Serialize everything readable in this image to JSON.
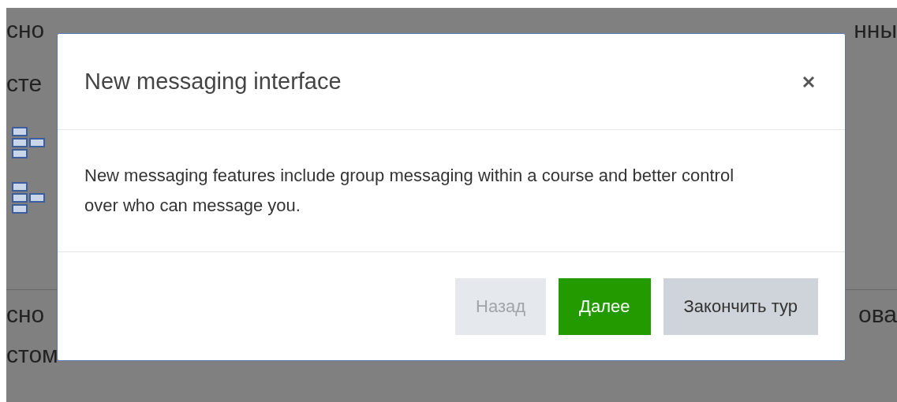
{
  "background": {
    "lines": [
      {
        "kind": "heading",
        "left": "сно",
        "right": "нны"
      },
      {
        "kind": "heading",
        "left": "сте"
      },
      {
        "kind": "resource"
      },
      {
        "kind": "resource"
      },
      {
        "kind": "divider"
      },
      {
        "kind": "heading",
        "left": "сно",
        "right": "ова"
      },
      {
        "kind": "heading",
        "left": "стом"
      }
    ]
  },
  "dialog": {
    "title": "New messaging interface",
    "body": "New messaging features include group messaging within a course and better control over who can message you.",
    "buttons": [
      {
        "label": "Назад",
        "kind": "back",
        "disabled": true
      },
      {
        "label": "Далее",
        "kind": "primary",
        "disabled": false
      },
      {
        "label": "Закончить тур",
        "kind": "secondary",
        "disabled": false
      }
    ]
  }
}
